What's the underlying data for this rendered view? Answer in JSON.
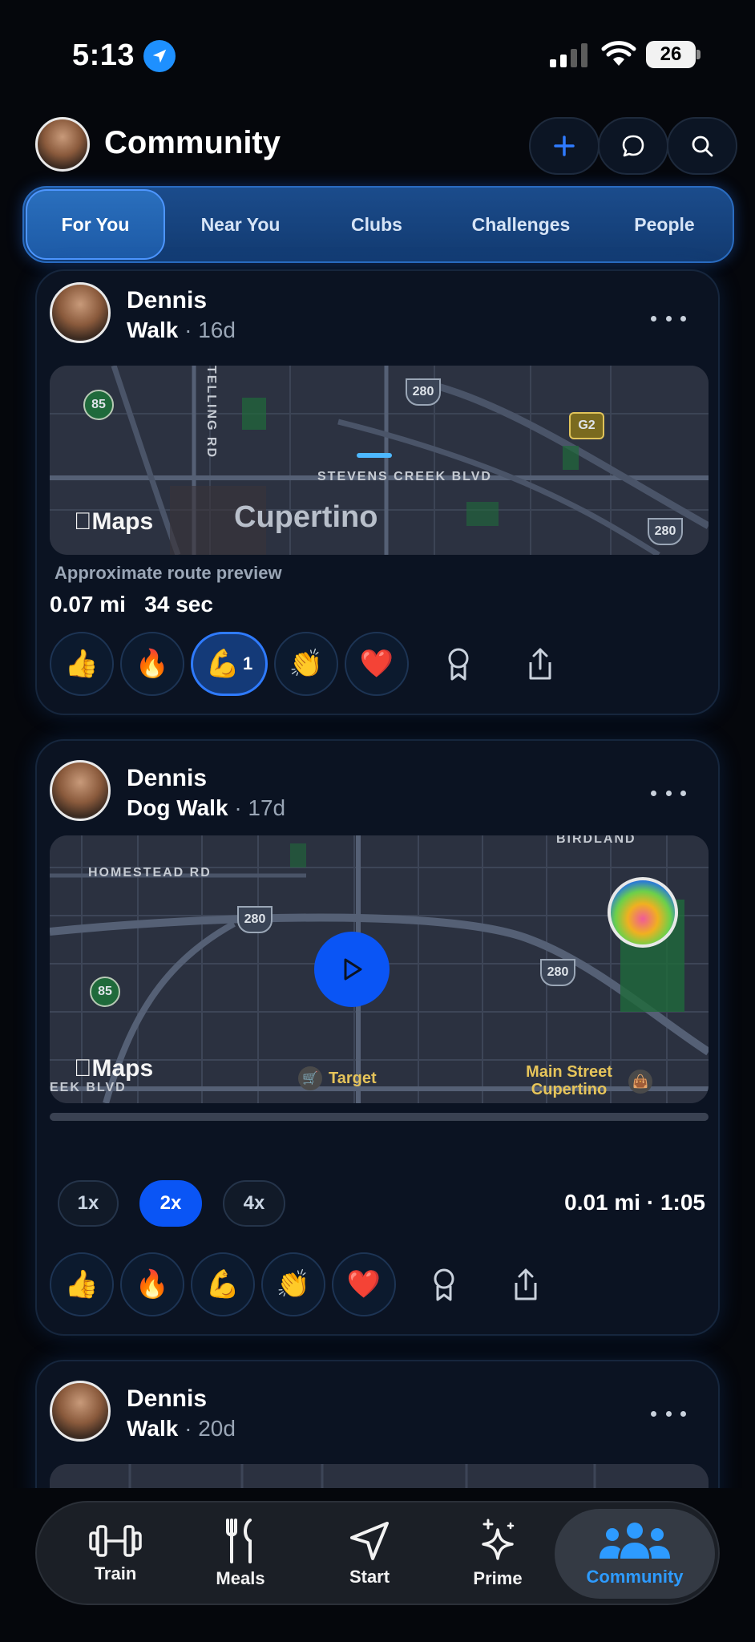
{
  "status": {
    "time": "5:13",
    "battery": "26"
  },
  "header": {
    "title": "Community"
  },
  "tabs": [
    "For You",
    "Near You",
    "Clubs",
    "Challenges",
    "People"
  ],
  "posts": [
    {
      "name": "Dennis",
      "activity": "Walk",
      "ago": "· 16d",
      "map": {
        "brand": "Maps",
        "city": "Cupertino",
        "street": "STEVENS CREEK BLVD",
        "road_v": "TELLING RD",
        "shields": [
          "85",
          "280",
          "G2",
          "280"
        ]
      },
      "route_note": "Approximate route preview",
      "distance": "0.07 mi",
      "duration": "34 sec",
      "reactions": [
        {
          "emoji": "👍",
          "count": ""
        },
        {
          "emoji": "🔥",
          "count": ""
        },
        {
          "emoji": "💪",
          "count": "1"
        },
        {
          "emoji": "👏",
          "count": ""
        },
        {
          "emoji": "❤️",
          "count": ""
        }
      ]
    },
    {
      "name": "Dennis",
      "activity": "Dog Walk",
      "ago": "· 17d",
      "map": {
        "brand": "Maps",
        "street1": "HOMESTEAD RD",
        "street2": "BIRDLAND",
        "street3": "EEK BLVD",
        "poi1": "Target",
        "poi2": "Main Street Cupertino",
        "shields": [
          "280",
          "85",
          "280"
        ]
      },
      "speeds": [
        "1x",
        "2x",
        "4x"
      ],
      "selected_speed": "2x",
      "summary": "0.01 mi · 1:05",
      "reactions": [
        {
          "emoji": "👍"
        },
        {
          "emoji": "🔥"
        },
        {
          "emoji": "💪"
        },
        {
          "emoji": "👏"
        },
        {
          "emoji": "❤️"
        }
      ]
    },
    {
      "name": "Dennis",
      "activity": "Walk",
      "ago": "· 20d"
    }
  ],
  "tabbar": [
    "Train",
    "Meals",
    "Start",
    "Prime",
    "Community"
  ],
  "colors": {
    "accent": "#0a55f5",
    "active_tab": "#2d9bff",
    "card_bg": "#0b1322"
  }
}
